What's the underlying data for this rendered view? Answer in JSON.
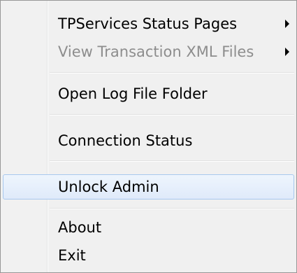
{
  "menu": {
    "items": [
      {
        "label": "TPServices Status Pages",
        "submenu": true,
        "enabled": true
      },
      {
        "label": "View Transaction XML Files",
        "submenu": true,
        "enabled": false
      },
      {
        "label": "Open Log File Folder",
        "submenu": false,
        "enabled": true
      },
      {
        "label": "Connection Status",
        "submenu": false,
        "enabled": true
      },
      {
        "label": "Unlock Admin",
        "submenu": false,
        "enabled": true,
        "highlighted": true
      },
      {
        "label": "About",
        "submenu": false,
        "enabled": true
      },
      {
        "label": "Exit",
        "submenu": false,
        "enabled": true
      }
    ],
    "colors": {
      "background": "#f0f0f0",
      "disabled_text": "#8d8d8d",
      "highlight_border": "#a8c8ee"
    },
    "icons": {
      "submenu": "submenu-arrow-icon"
    }
  }
}
